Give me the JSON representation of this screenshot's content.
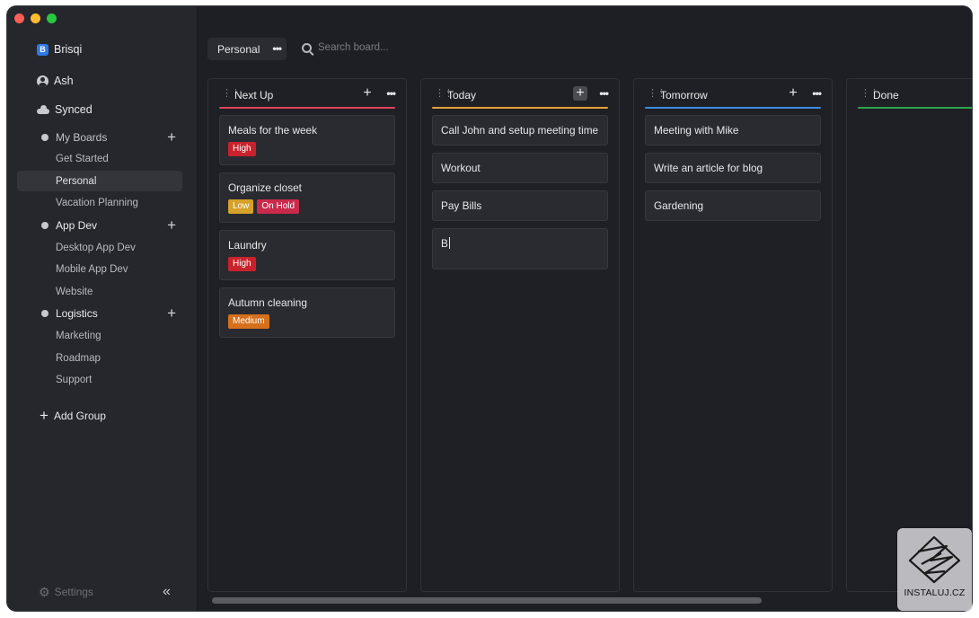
{
  "app": {
    "name": "Brisqi"
  },
  "sidebar": {
    "user": "Ash",
    "sync_status": "Synced",
    "groups": [
      {
        "label": "My Boards",
        "boards": [
          "Get Started",
          "Personal",
          "Vacation Planning"
        ]
      },
      {
        "label": "App Dev",
        "boards": [
          "Desktop App Dev",
          "Mobile App Dev",
          "Website"
        ]
      },
      {
        "label": "Logistics",
        "boards": [
          "Marketing",
          "Roadmap",
          "Support"
        ]
      }
    ],
    "active_board": "Personal",
    "add_group_label": "Add Group",
    "settings_label": "Settings"
  },
  "toolbar": {
    "board_name": "Personal",
    "search_placeholder": "Search board..."
  },
  "columns": [
    {
      "title": "Next Up",
      "accent": "#e0435a",
      "cards": [
        {
          "title": "Meals for the week",
          "tags": [
            {
              "label": "High",
              "color": "#c8232c"
            }
          ]
        },
        {
          "title": "Organize closet",
          "tags": [
            {
              "label": "Low",
              "color": "#d6a12a"
            },
            {
              "label": "On Hold",
              "color": "#c92a4b"
            }
          ]
        },
        {
          "title": "Laundry",
          "tags": [
            {
              "label": "High",
              "color": "#c8232c"
            }
          ]
        },
        {
          "title": "Autumn cleaning",
          "tags": [
            {
              "label": "Medium",
              "color": "#d6701c"
            }
          ]
        }
      ]
    },
    {
      "title": "Today",
      "accent": "#e6a03c",
      "cards": [
        {
          "title": "Call John and setup meeting time",
          "tags": []
        },
        {
          "title": "Workout",
          "tags": []
        },
        {
          "title": "Pay Bills",
          "tags": []
        }
      ],
      "new_card_input": "B"
    },
    {
      "title": "Tomorrow",
      "accent": "#3b8de0",
      "cards": [
        {
          "title": "Meeting with Mike",
          "tags": []
        },
        {
          "title": "Write an article for blog",
          "tags": []
        },
        {
          "title": "Gardening",
          "tags": []
        }
      ]
    },
    {
      "title": "Done",
      "accent": "#2fa34e",
      "cards": []
    }
  ],
  "watermark": {
    "text": "INSTALUJ.CZ"
  }
}
